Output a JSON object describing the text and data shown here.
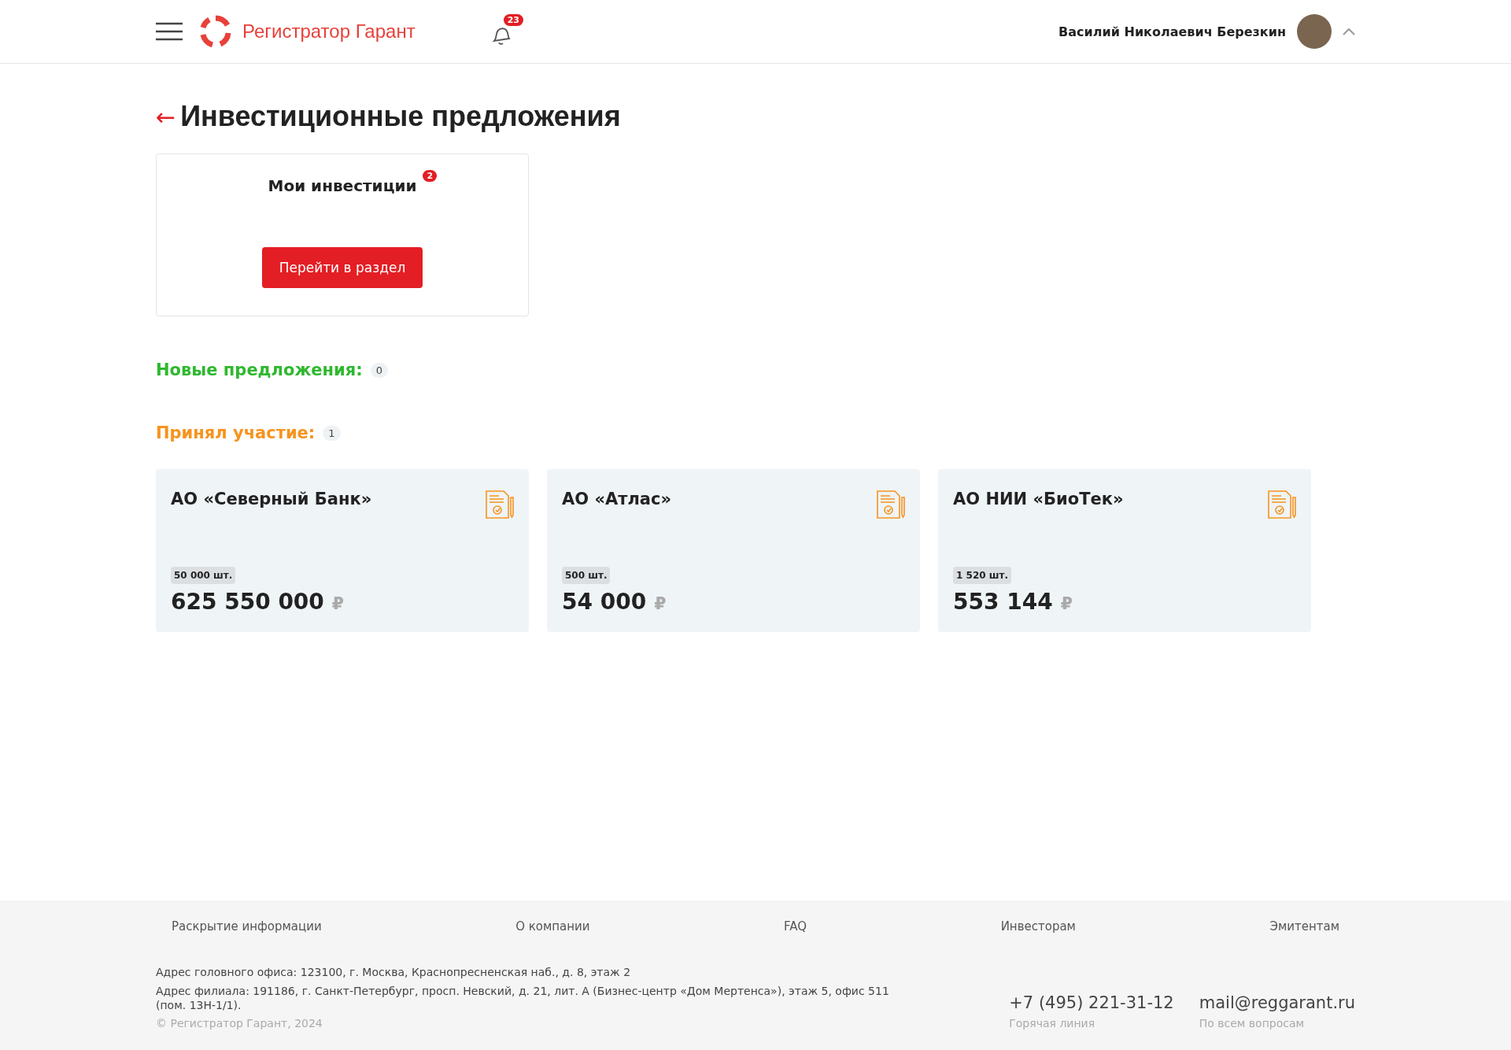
{
  "header": {
    "logo_text": "Регистратор Гарант",
    "notifications_count": "23",
    "user_name": "Василий Николаевич Березкин"
  },
  "page": {
    "back_arrow": "←",
    "title": "Инвестиционные предложения"
  },
  "my_investments": {
    "title": "Мои инвестиции",
    "badge": "2",
    "button": "Перейти в раздел"
  },
  "sections": [
    {
      "title": "Новые предложения:",
      "count": "0",
      "color": "#2fb82f"
    },
    {
      "title": "Принял участие:",
      "count": "1",
      "color": "#f7931e",
      "items": [
        {
          "name": "АО «Северный Банк»",
          "quantity": "50 000 шт.",
          "amount": "625 550 000",
          "currency": "₽"
        },
        {
          "name": "АО «Атлас»",
          "quantity": "500 шт.",
          "amount": "54 000",
          "currency": "₽"
        },
        {
          "name": "АО НИИ «БиоТек»",
          "quantity": "1 520 шт.",
          "amount": "553 144",
          "currency": "₽"
        }
      ]
    }
  ],
  "footer": {
    "links": [
      "Раскрытие информации",
      "О компании",
      "FAQ",
      "Инвесторам",
      "Эмитентам"
    ],
    "addresses": [
      "Адрес головного офиса: 123100, г. Москва, Краснопресненская наб., д. 8, этаж 2",
      "Адрес филиала: 191186, г. Санкт-Петербург, просп. Невский, д. 21, лит. А (Бизнес-центр «Дом Мертенса»), этаж 5, офис 511 (пом. 13Н-1/1)."
    ],
    "copyright": "© Регистратор Гарант, 2024",
    "contacts": [
      {
        "value": "+7 (495) 221-31-12",
        "caption": "Горячая линия"
      },
      {
        "value": "mail@reggarant.ru",
        "caption": "По всем вопросам"
      }
    ]
  }
}
